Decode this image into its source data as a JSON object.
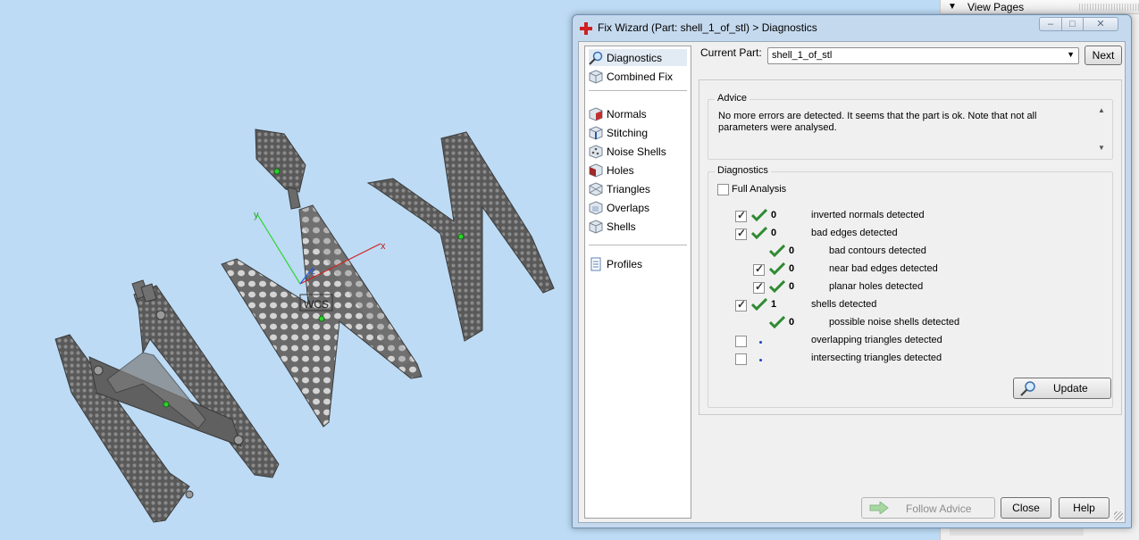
{
  "background_panel": {
    "header_label": "View Pages"
  },
  "viewport": {
    "wcs_label": "WCS",
    "axis_x": "x",
    "axis_y": "y",
    "axis_z": "z"
  },
  "dialog": {
    "title": "Fix Wizard (Part: shell_1_of_stl) > Diagnostics",
    "window_buttons": {
      "minimize": "–",
      "maximize": "□",
      "close": "✕"
    }
  },
  "nav": {
    "items": [
      {
        "label": "Diagnostics",
        "icon": "magnifier-icon",
        "selected": true
      },
      {
        "label": "Combined Fix",
        "icon": "cube-icon"
      },
      {
        "label": "Normals",
        "icon": "normals-cube-icon"
      },
      {
        "label": "Stitching",
        "icon": "stitching-cube-icon"
      },
      {
        "label": "Noise Shells",
        "icon": "noise-shells-icon"
      },
      {
        "label": "Holes",
        "icon": "holes-cube-icon"
      },
      {
        "label": "Triangles",
        "icon": "triangles-cube-icon"
      },
      {
        "label": "Overlaps",
        "icon": "overlaps-cube-icon"
      },
      {
        "label": "Shells",
        "icon": "shells-cube-icon"
      },
      {
        "label": "Profiles",
        "icon": "profiles-document-icon"
      }
    ]
  },
  "current_part": {
    "label": "Current Part:",
    "value": "shell_1_of_stl",
    "next_label": "Next"
  },
  "advice": {
    "title": "Advice",
    "text": "No more errors are detected. It seems that the part is ok. Note that not all parameters were analysed."
  },
  "diagnostics": {
    "title": "Diagnostics",
    "full_analysis_label": "Full Analysis",
    "full_analysis_checked": false,
    "rows": [
      {
        "checked": true,
        "status": "ok",
        "count": "0",
        "label": "inverted normals detected"
      },
      {
        "checked": true,
        "status": "ok",
        "count": "0",
        "label": "bad edges detected"
      },
      {
        "checked": null,
        "status": "ok",
        "count": "0",
        "label": "bad contours detected"
      },
      {
        "checked": true,
        "status": "ok",
        "count": "0",
        "label": "near bad edges detected"
      },
      {
        "checked": true,
        "status": "ok",
        "count": "0",
        "label": "planar holes detected"
      },
      {
        "checked": true,
        "status": "ok",
        "count": "1",
        "label": "shells detected"
      },
      {
        "checked": null,
        "status": "ok",
        "count": "0",
        "label": "possible noise shells detected"
      },
      {
        "checked": false,
        "status": "not-run",
        "count": "",
        "label": "overlapping triangles detected"
      },
      {
        "checked": false,
        "status": "not-run",
        "count": "",
        "label": "intersecting triangles detected"
      }
    ],
    "update_label": "Update"
  },
  "footer": {
    "follow_advice_label": "Follow Advice",
    "close_label": "Close",
    "help_label": "Help"
  },
  "colors": {
    "viewport_bg": "#bddbf5",
    "model_fill": "#5d5d5d",
    "check_green": "#2f8a32",
    "not_run_dot": "#1a44c8"
  }
}
